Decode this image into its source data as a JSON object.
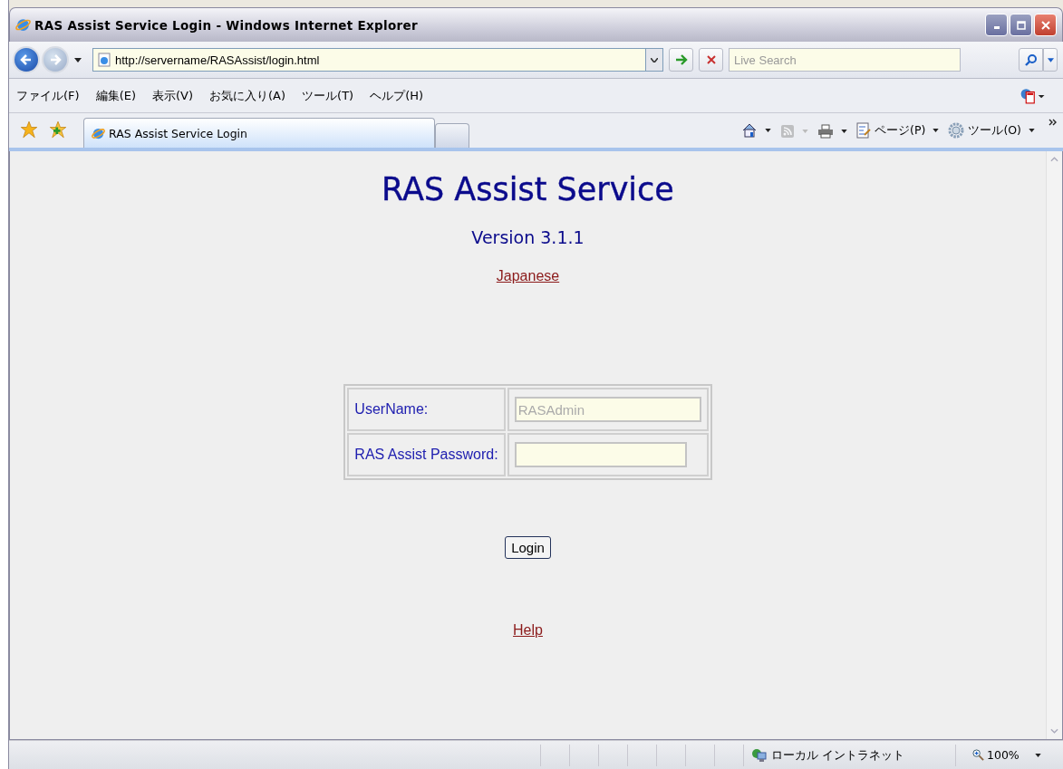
{
  "window": {
    "title": "RAS Assist Service Login - Windows Internet Explorer"
  },
  "address_bar": {
    "url": "http://servername/RASAssist/login.html"
  },
  "search": {
    "placeholder": "Live Search"
  },
  "menu": [
    "ファイル(F)",
    "編集(E)",
    "表示(V)",
    "お気に入り(A)",
    "ツール(T)",
    "ヘルプ(H)"
  ],
  "tabs": [
    {
      "label": "RAS Assist Service Login",
      "selected": true
    }
  ],
  "command_bar": [
    {
      "kind": "home"
    },
    {
      "kind": "feeds",
      "disabled": true
    },
    {
      "kind": "print"
    },
    {
      "kind": "page",
      "label": "ページ(P)"
    },
    {
      "kind": "tools",
      "label": "ツール(O)"
    }
  ],
  "page": {
    "heading": "RAS Assist Service",
    "version": "Version 3.1.1",
    "language_link": "Japanese",
    "form": [
      {
        "label": "UserName:",
        "value": "RASAdmin",
        "disabled": true
      },
      {
        "label": "RAS Assist Password:"
      }
    ],
    "submit": "Login",
    "help_link": "Help"
  },
  "status_bar": {
    "zone": "ローカル イントラネット",
    "zoom": "100%"
  }
}
